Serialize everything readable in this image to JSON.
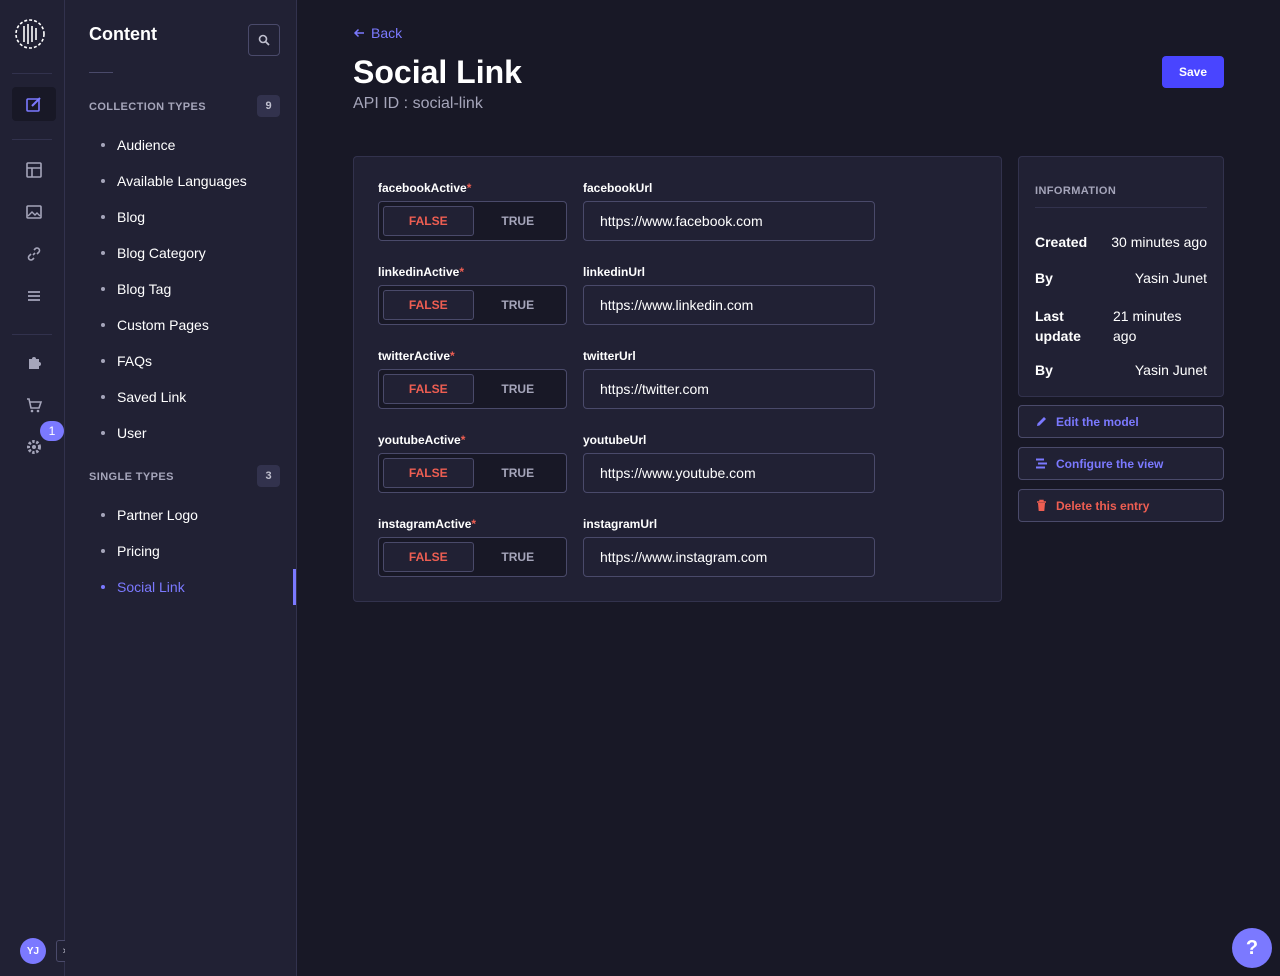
{
  "rail": {
    "notification_count": "1",
    "user_initials": "YJ"
  },
  "sidebar": {
    "title": "Content",
    "collection_header": "COLLECTION TYPES",
    "collection_count": "9",
    "collection_items": [
      "Audience",
      "Available Languages",
      "Blog",
      "Blog Category",
      "Blog Tag",
      "Custom Pages",
      "FAQs",
      "Saved Link",
      "User"
    ],
    "single_header": "SINGLE TYPES",
    "single_count": "3",
    "single_items": [
      "Partner Logo",
      "Pricing",
      "Social Link"
    ],
    "active_item": "Social Link"
  },
  "header": {
    "back_label": "Back",
    "title": "Social Link",
    "api_id": "API ID : social-link",
    "save_label": "Save"
  },
  "fields": [
    {
      "toggle_label": "facebookActive",
      "url_label": "facebookUrl",
      "url_value": "https://www.facebook.com"
    },
    {
      "toggle_label": "linkedinActive",
      "url_label": "linkedinUrl",
      "url_value": "https://www.linkedin.com"
    },
    {
      "toggle_label": "twitterActive",
      "url_label": "twitterUrl",
      "url_value": "https://twitter.com"
    },
    {
      "toggle_label": "youtubeActive",
      "url_label": "youtubeUrl",
      "url_value": "https://www.youtube.com"
    },
    {
      "toggle_label": "instagramActive",
      "url_label": "instagramUrl",
      "url_value": "https://www.instagram.com"
    }
  ],
  "toggle": {
    "false_label": "FALSE",
    "true_label": "TRUE",
    "required_mark": "*"
  },
  "info": {
    "header": "INFORMATION",
    "created_label": "Created",
    "created_value": "30 minutes ago",
    "by_label": "By",
    "created_by": "Yasin Junet",
    "updated_label_1": "Last",
    "updated_label_2": "update",
    "updated_value_1": "21 minutes",
    "updated_value_2": "ago",
    "updated_by_label": "By",
    "updated_by": "Yasin Junet"
  },
  "actions": {
    "edit_model": "Edit the model",
    "configure_view": "Configure the view",
    "delete_entry": "Delete this entry"
  },
  "help_label": "?",
  "colors": {
    "background": "#181826",
    "panel": "#212134",
    "accent": "#7b79ff",
    "primary_button": "#4945ff",
    "danger": "#ee5e52"
  }
}
